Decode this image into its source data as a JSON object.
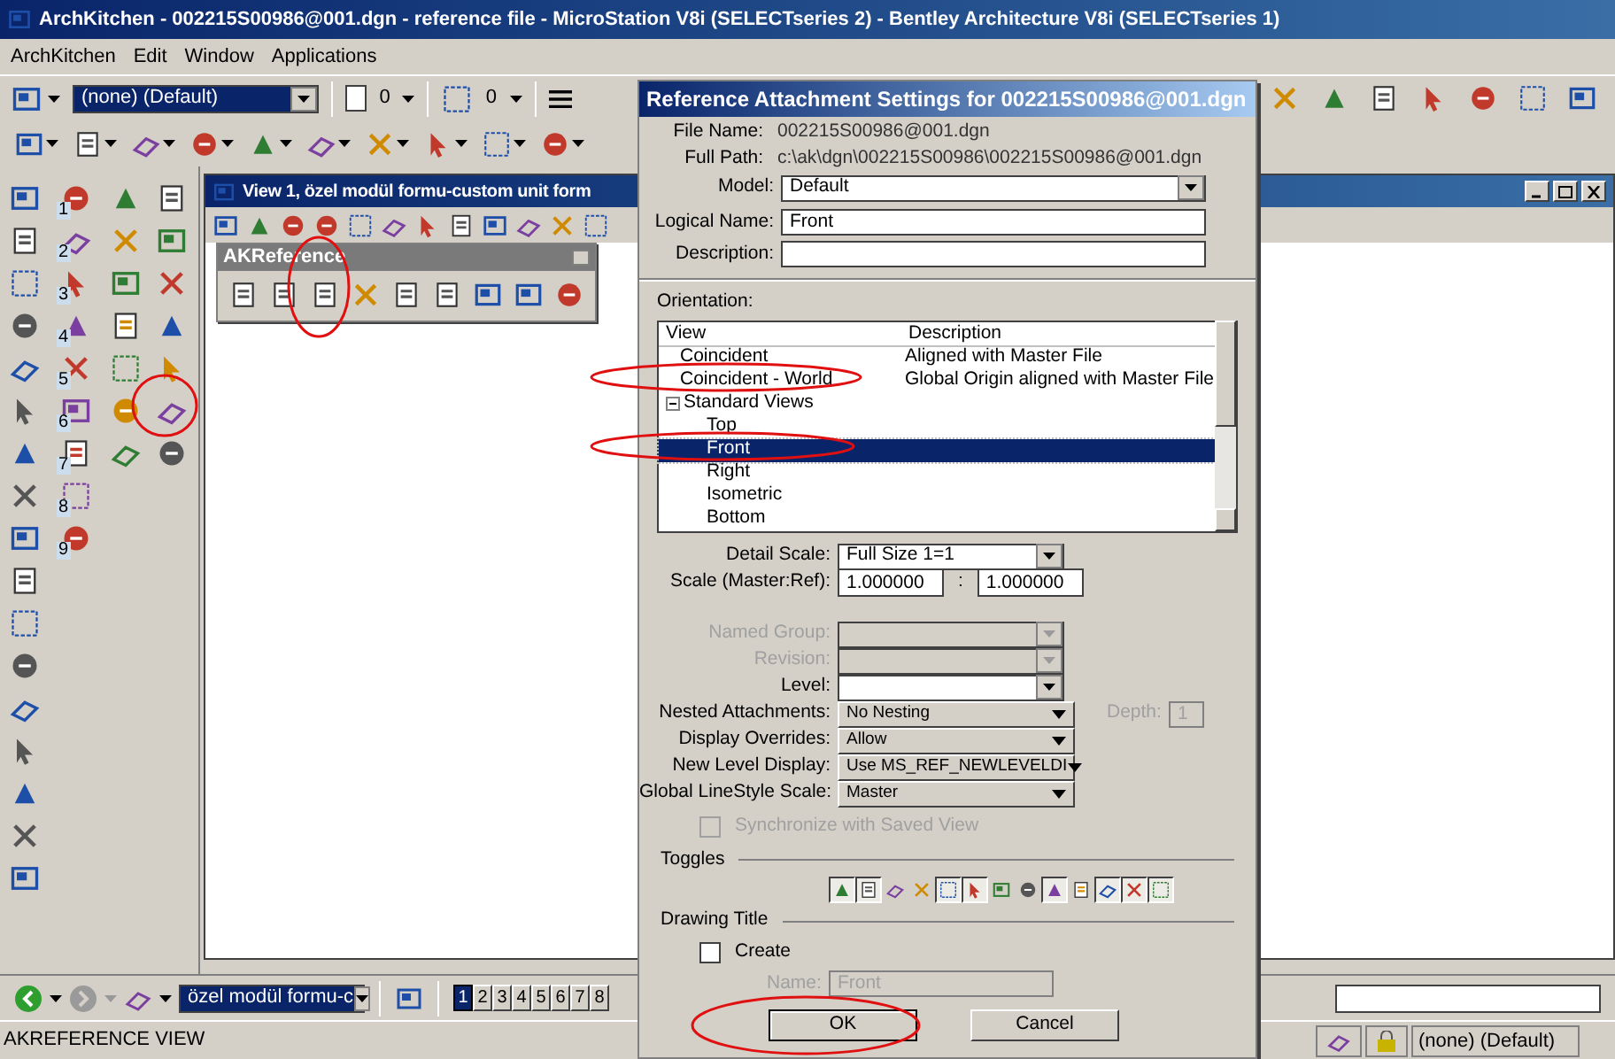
{
  "window": {
    "title": "ArchKitchen - 002215S00986@001.dgn - reference file - MicroStation V8i (SELECTseries 2) - Bentley Architecture V8i (SELECTseries 1)"
  },
  "menu": [
    "ArchKitchen",
    "Edit",
    "Window",
    "Applications"
  ],
  "attributes_toolbar": {
    "level": "(none) (Default)",
    "color_value": "0",
    "style_value": "0"
  },
  "tool_palette": {
    "numbers": [
      "1",
      "2",
      "3",
      "4",
      "5",
      "6",
      "7",
      "8",
      "9"
    ]
  },
  "view_window": {
    "title": "View 1, özel modül formu-custom unit form"
  },
  "akreference": {
    "title": "AKReference"
  },
  "dialog": {
    "title": "Reference Attachment Settings for 002215S00986@001.dgn",
    "info": [
      {
        "label": "File Name:",
        "value": "002215S00986@001.dgn"
      },
      {
        "label": "Full Path:",
        "value": "c:\\ak\\dgn\\002215S00986\\002215S00986@001.dgn"
      }
    ],
    "model": {
      "label": "Model:",
      "value": "Default"
    },
    "logical_name": {
      "label": "Logical Name:",
      "value": "Front"
    },
    "description": {
      "label": "Description:"
    },
    "orientation": {
      "label": "Orientation:",
      "columns": [
        "View",
        "Description"
      ],
      "rows": [
        {
          "view": "Coincident",
          "description": "Aligned with Master File",
          "selected": false
        },
        {
          "view": "Coincident - World",
          "description": "Global Origin aligned with Master File",
          "selected": false
        },
        {
          "view": "Standard Views",
          "selected": false,
          "expanded": true,
          "children": [
            {
              "view": "Top",
              "selected": false
            },
            {
              "view": "Front",
              "selected": true
            },
            {
              "view": "Right",
              "selected": false
            },
            {
              "view": "Isometric",
              "selected": false
            },
            {
              "view": "Bottom",
              "selected": false
            }
          ]
        }
      ]
    },
    "fields": [
      {
        "kind": "combo",
        "label": "Detail Scale:",
        "value": "Full Size 1=1",
        "disabled": false
      },
      {
        "kind": "ratio",
        "label": "Scale (Master:Ref):",
        "value": "1.000000",
        "separator": ":",
        "value2": "1.000000",
        "disabled": false
      },
      {
        "kind": "gap"
      },
      {
        "kind": "combo",
        "label": "Named Group:",
        "disabled": true
      },
      {
        "kind": "combo",
        "label": "Revision:",
        "disabled": true
      },
      {
        "kind": "combo",
        "label": "Level:",
        "disabled": false
      },
      {
        "kind": "button",
        "label": "Nested Attachments:",
        "value": "No Nesting",
        "disabled": false,
        "depth": {
          "label": "Depth:",
          "value": "1",
          "disabled": true
        }
      },
      {
        "kind": "button",
        "label": "Display Overrides:",
        "value": "Allow",
        "disabled": false
      },
      {
        "kind": "button",
        "label": "New Level Display:",
        "value": "Use MS_REF_NEWLEVELDI",
        "disabled": false
      },
      {
        "kind": "button",
        "label": "Global LineStyle Scale:",
        "value": "Master",
        "disabled": false
      }
    ],
    "sync": {
      "label": "Synchronize with Saved View",
      "checked": false,
      "disabled": true
    },
    "toggles": {
      "label": "Toggles",
      "items": [
        {
          "on": true
        },
        {
          "on": true
        },
        {
          "on": false
        },
        {
          "on": false
        },
        {
          "on": true
        },
        {
          "on": true
        },
        {
          "on": false
        },
        {
          "on": false
        },
        {
          "on": true
        },
        {
          "on": false
        },
        {
          "on": true
        },
        {
          "on": true
        },
        {
          "on": true
        }
      ]
    },
    "drawing_title": {
      "label": "Drawing Title",
      "create": {
        "label": "Create",
        "checked": false
      },
      "name_label": "Name:",
      "name_value": "Front",
      "disabled": true
    },
    "buttons": [
      "OK",
      "Cancel"
    ]
  },
  "view_bar": {
    "view_name": "özel modül formu-c",
    "views": [
      {
        "label": "1",
        "selected": true
      },
      {
        "label": "2",
        "selected": false
      },
      {
        "label": "3",
        "selected": false
      },
      {
        "label": "4",
        "selected": false
      },
      {
        "label": "5",
        "selected": false
      },
      {
        "label": "6",
        "selected": false
      },
      {
        "label": "7",
        "selected": false
      },
      {
        "label": "8",
        "selected": false
      }
    ]
  },
  "status_bar": {
    "message": "AKREFERENCE VIEW",
    "level": "(none) (Default)"
  }
}
